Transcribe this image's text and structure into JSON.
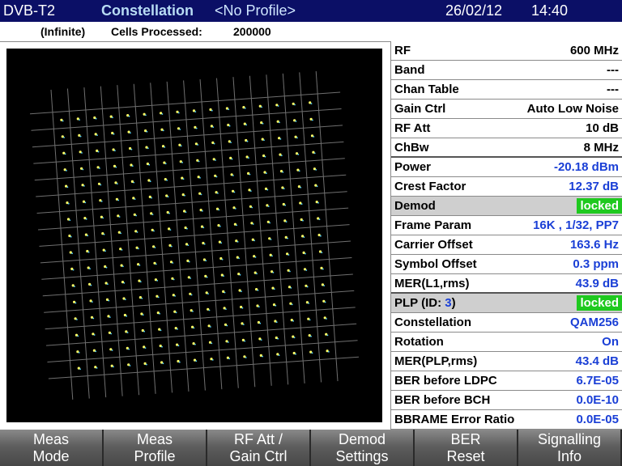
{
  "header": {
    "standard": "DVB-T2",
    "mode": "Constellation",
    "profile": "<No Profile>",
    "date": "26/02/12",
    "time": "14:40"
  },
  "info": {
    "infinite": "(Infinite)",
    "cells_label": "Cells Processed:",
    "cells_value": "200000"
  },
  "constellation": {
    "modulation": "QAM256",
    "grid_size": 16,
    "rotated": true,
    "background_color": "#000000",
    "point_color": "#ffff66"
  },
  "measurements": [
    {
      "label": "RF",
      "value": "600 MHz",
      "style": "black"
    },
    {
      "label": "Band",
      "value": "---",
      "style": "black"
    },
    {
      "label": "Chan Table",
      "value": "---",
      "style": "black"
    },
    {
      "label": "Gain Ctrl",
      "value": "Auto Low Noise",
      "style": "black"
    },
    {
      "label": "RF Att",
      "value": "10 dB",
      "style": "black"
    },
    {
      "label": "ChBw",
      "value": "8 MHz",
      "style": "black",
      "sep": true
    },
    {
      "label": "Power",
      "value": "-20.18 dBm",
      "style": "blue"
    },
    {
      "label": "Crest Factor",
      "value": "12.37 dB",
      "style": "blue"
    },
    {
      "label": "Demod",
      "value": "locked",
      "style": "green",
      "header": true
    },
    {
      "label": "Frame Param",
      "value": "16K ,  1/32,  PP7",
      "style": "blue"
    },
    {
      "label": "Carrier Offset",
      "value": "163.6 Hz",
      "style": "blue"
    },
    {
      "label": "Symbol Offset",
      "value": "0.3 ppm",
      "style": "blue"
    },
    {
      "label": "MER(L1,rms)",
      "value": "43.9 dB",
      "style": "blue",
      "sep": true
    },
    {
      "label": "PLP (ID:",
      "label_id": "3",
      "label_end": ")",
      "value": "locked",
      "style": "green",
      "header": true
    },
    {
      "label": "Constellation",
      "value": "QAM256",
      "style": "blue"
    },
    {
      "label": "Rotation",
      "value": "On",
      "style": "blue"
    },
    {
      "label": "MER(PLP,rms)",
      "value": "43.4 dB",
      "style": "blue"
    },
    {
      "label": "BER before LDPC",
      "value": "6.7E-05",
      "style": "blue"
    },
    {
      "label": "BER before BCH",
      "value": "0.0E-10",
      "style": "blue"
    },
    {
      "label": "BBRAME Error Ratio",
      "value": "0.0E-05",
      "style": "blue"
    }
  ],
  "softkeys": [
    {
      "line1": "Meas",
      "line2": "Mode"
    },
    {
      "line1": "Meas",
      "line2": "Profile"
    },
    {
      "line1": "RF Att /",
      "line2": "Gain Ctrl"
    },
    {
      "line1": "Demod",
      "line2": "Settings"
    },
    {
      "line1": "BER",
      "line2": "Reset"
    },
    {
      "line1": "Signalling",
      "line2": "Info"
    }
  ]
}
